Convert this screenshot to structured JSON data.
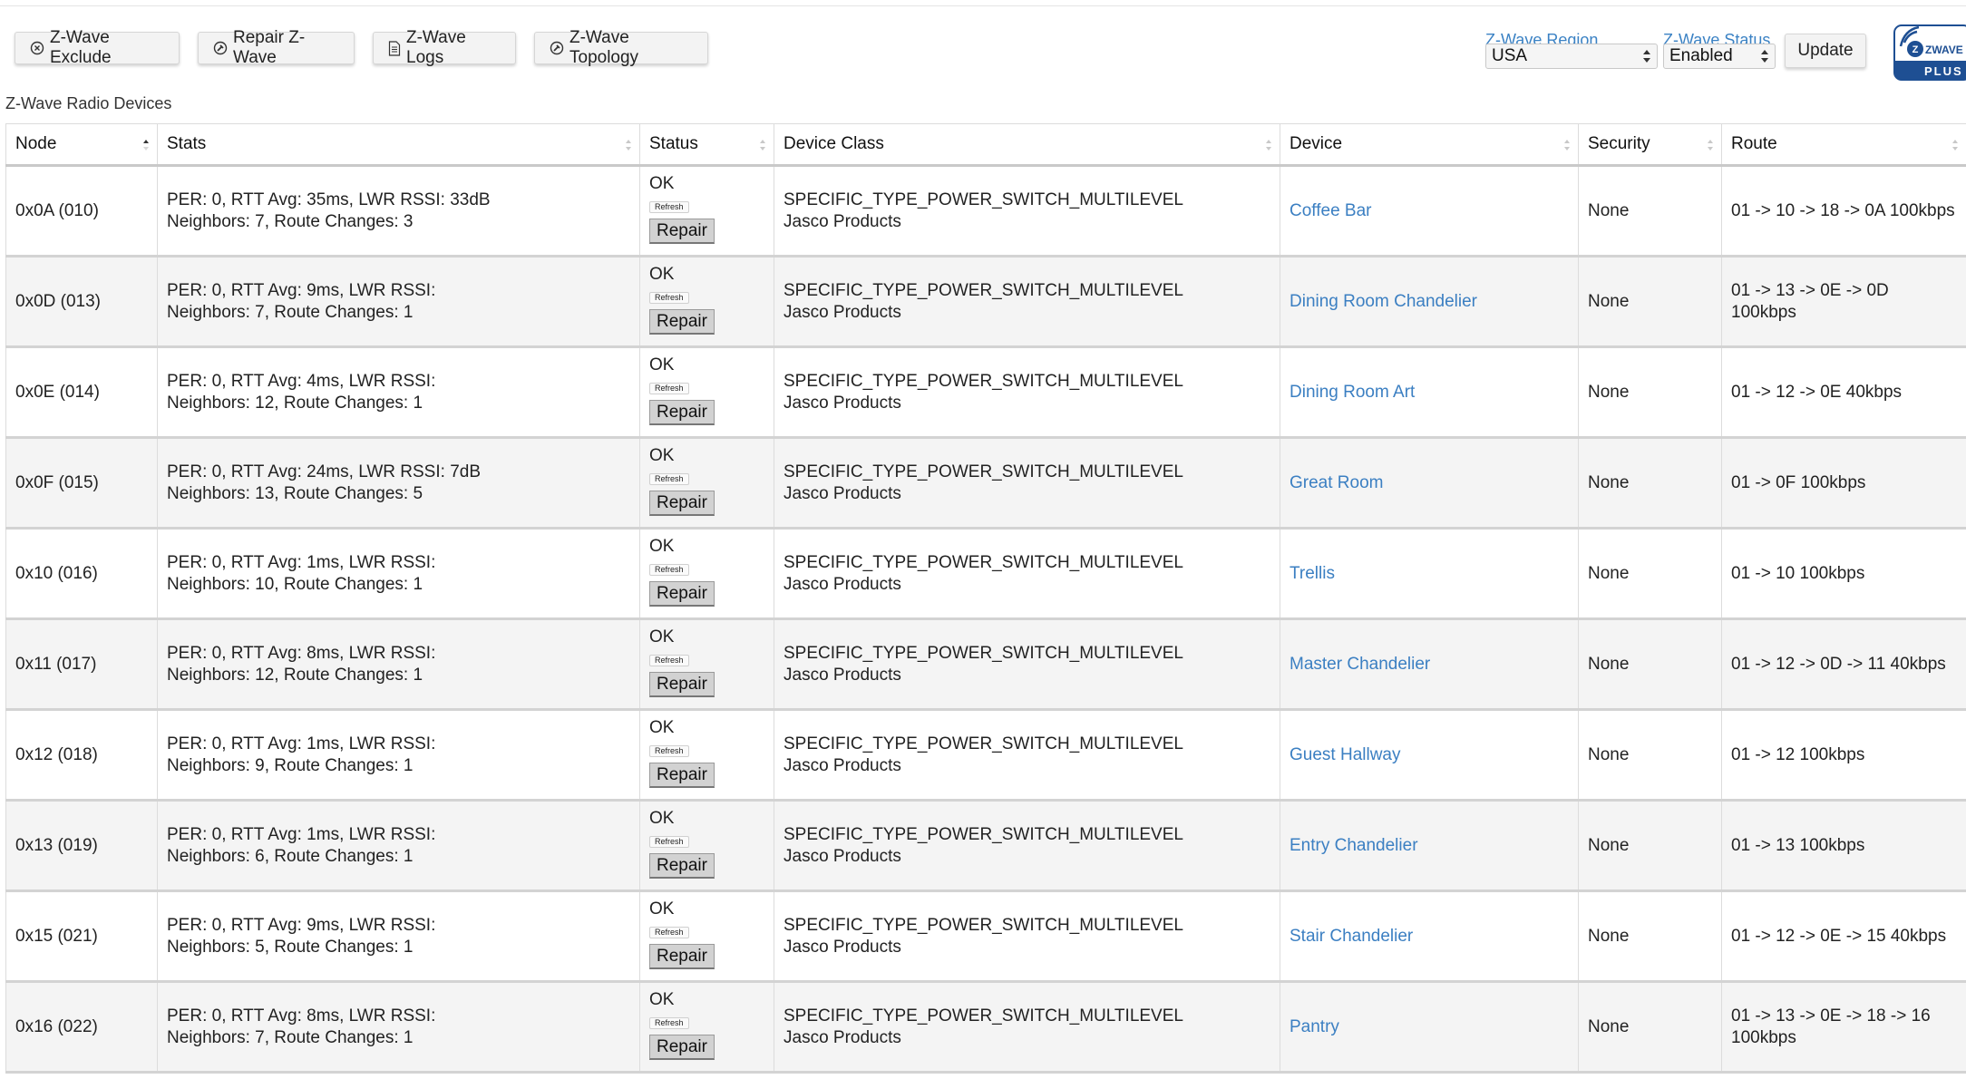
{
  "toolbar": {
    "exclude_label": "Z-Wave Exclude",
    "repair_label": "Repair Z-Wave",
    "logs_label": "Z-Wave Logs",
    "topology_label": "Z-Wave Topology"
  },
  "region": {
    "label": "Z-Wave Region",
    "value": "USA"
  },
  "zwave_status": {
    "label": "Z-Wave Status",
    "value": "Enabled"
  },
  "update_label": "Update",
  "logo": {
    "top": "ZWAVE",
    "bottom": "PLUS"
  },
  "section_title": "Z-Wave Radio Devices",
  "columns": {
    "node": "Node",
    "stats": "Stats",
    "status": "Status",
    "device_class": "Device Class",
    "device": "Device",
    "security": "Security",
    "route": "Route"
  },
  "colors": {
    "link": "#3b7fc2",
    "label": "#3b82c4",
    "logo_blue": "#1e4f93"
  },
  "row_labels": {
    "refresh": "Refresh",
    "repair": "Repair"
  },
  "rows": [
    {
      "node": "0x0A (010)",
      "stats1": "PER: 0, RTT Avg: 35ms, LWR RSSI: 33dB",
      "stats2": "Neighbors: 7, Route Changes: 3",
      "status": "OK",
      "class1": "SPECIFIC_TYPE_POWER_SWITCH_MULTILEVEL",
      "class2": "Jasco Products",
      "device": "Coffee Bar",
      "security": "None",
      "route": "01 -> 10 -> 18 -> 0A 100kbps"
    },
    {
      "node": "0x0D (013)",
      "stats1": "PER: 0, RTT Avg: 9ms, LWR RSSI:",
      "stats2": "Neighbors: 7, Route Changes: 1",
      "status": "OK",
      "class1": "SPECIFIC_TYPE_POWER_SWITCH_MULTILEVEL",
      "class2": "Jasco Products",
      "device": "Dining Room Chandelier",
      "security": "None",
      "route": "01 -> 13 -> 0E -> 0D 100kbps"
    },
    {
      "node": "0x0E (014)",
      "stats1": "PER: 0, RTT Avg: 4ms, LWR RSSI:",
      "stats2": "Neighbors: 12, Route Changes: 1",
      "status": "OK",
      "class1": "SPECIFIC_TYPE_POWER_SWITCH_MULTILEVEL",
      "class2": "Jasco Products",
      "device": "Dining Room Art",
      "security": "None",
      "route": "01 -> 12 -> 0E 40kbps"
    },
    {
      "node": "0x0F (015)",
      "stats1": "PER: 0, RTT Avg: 24ms, LWR RSSI: 7dB",
      "stats2": "Neighbors: 13, Route Changes: 5",
      "status": "OK",
      "class1": "SPECIFIC_TYPE_POWER_SWITCH_MULTILEVEL",
      "class2": "Jasco Products",
      "device": "Great Room",
      "security": "None",
      "route": "01 -> 0F 100kbps"
    },
    {
      "node": "0x10 (016)",
      "stats1": "PER: 0, RTT Avg: 1ms, LWR RSSI:",
      "stats2": "Neighbors: 10, Route Changes: 1",
      "status": "OK",
      "class1": "SPECIFIC_TYPE_POWER_SWITCH_MULTILEVEL",
      "class2": "Jasco Products",
      "device": "Trellis",
      "security": "None",
      "route": "01 -> 10 100kbps"
    },
    {
      "node": "0x11 (017)",
      "stats1": "PER: 0, RTT Avg: 8ms, LWR RSSI:",
      "stats2": "Neighbors: 12, Route Changes: 1",
      "status": "OK",
      "class1": "SPECIFIC_TYPE_POWER_SWITCH_MULTILEVEL",
      "class2": "Jasco Products",
      "device": "Master Chandelier",
      "security": "None",
      "route": "01 -> 12 -> 0D -> 11 40kbps"
    },
    {
      "node": "0x12 (018)",
      "stats1": "PER: 0, RTT Avg: 1ms, LWR RSSI:",
      "stats2": "Neighbors: 9, Route Changes: 1",
      "status": "OK",
      "class1": "SPECIFIC_TYPE_POWER_SWITCH_MULTILEVEL",
      "class2": "Jasco Products",
      "device": "Guest Hallway",
      "security": "None",
      "route": "01 -> 12 100kbps"
    },
    {
      "node": "0x13 (019)",
      "stats1": "PER: 0, RTT Avg: 1ms, LWR RSSI:",
      "stats2": "Neighbors: 6, Route Changes: 1",
      "status": "OK",
      "class1": "SPECIFIC_TYPE_POWER_SWITCH_MULTILEVEL",
      "class2": "Jasco Products",
      "device": "Entry Chandelier",
      "security": "None",
      "route": "01 -> 13 100kbps"
    },
    {
      "node": "0x15 (021)",
      "stats1": "PER: 0, RTT Avg: 9ms, LWR RSSI:",
      "stats2": "Neighbors: 5, Route Changes: 1",
      "status": "OK",
      "class1": "SPECIFIC_TYPE_POWER_SWITCH_MULTILEVEL",
      "class2": "Jasco Products",
      "device": "Stair Chandelier",
      "security": "None",
      "route": "01 -> 12 -> 0E -> 15 40kbps"
    },
    {
      "node": "0x16 (022)",
      "stats1": "PER: 0, RTT Avg: 8ms, LWR RSSI:",
      "stats2": "Neighbors: 7, Route Changes: 1",
      "status": "OK",
      "class1": "SPECIFIC_TYPE_POWER_SWITCH_MULTILEVEL",
      "class2": "Jasco Products",
      "device": "Pantry",
      "security": "None",
      "route1": "01 -> 13 -> 0E -> 18 -> 16",
      "route2": "100kbps"
    }
  ]
}
